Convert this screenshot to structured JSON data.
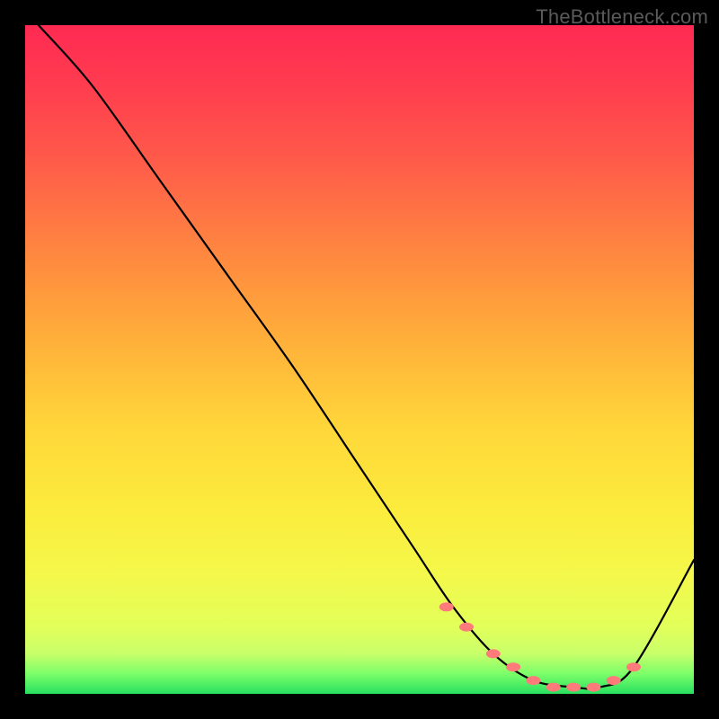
{
  "watermark": "TheBottleneck.com",
  "chart_data": {
    "type": "line",
    "title": "",
    "xlabel": "",
    "ylabel": "",
    "xlim": [
      0,
      100
    ],
    "ylim": [
      0,
      100
    ],
    "grid": false,
    "legend": false,
    "annotations": [],
    "series": [
      {
        "name": "bottleneck-curve",
        "color": "#000000",
        "x": [
          2,
          10,
          20,
          30,
          40,
          50,
          58,
          64,
          70,
          76,
          82,
          86,
          91,
          100
        ],
        "values": [
          100,
          91,
          77,
          63,
          49,
          34,
          22,
          13,
          6,
          2,
          1,
          1,
          4,
          20
        ]
      },
      {
        "name": "bottleneck-dots",
        "color": "#ff7a7a",
        "type": "scatter",
        "x": [
          63,
          66,
          70,
          73,
          76,
          79,
          82,
          85,
          88,
          91
        ],
        "values": [
          13,
          10,
          6,
          4,
          2,
          1,
          1,
          1,
          2,
          4
        ]
      }
    ]
  }
}
